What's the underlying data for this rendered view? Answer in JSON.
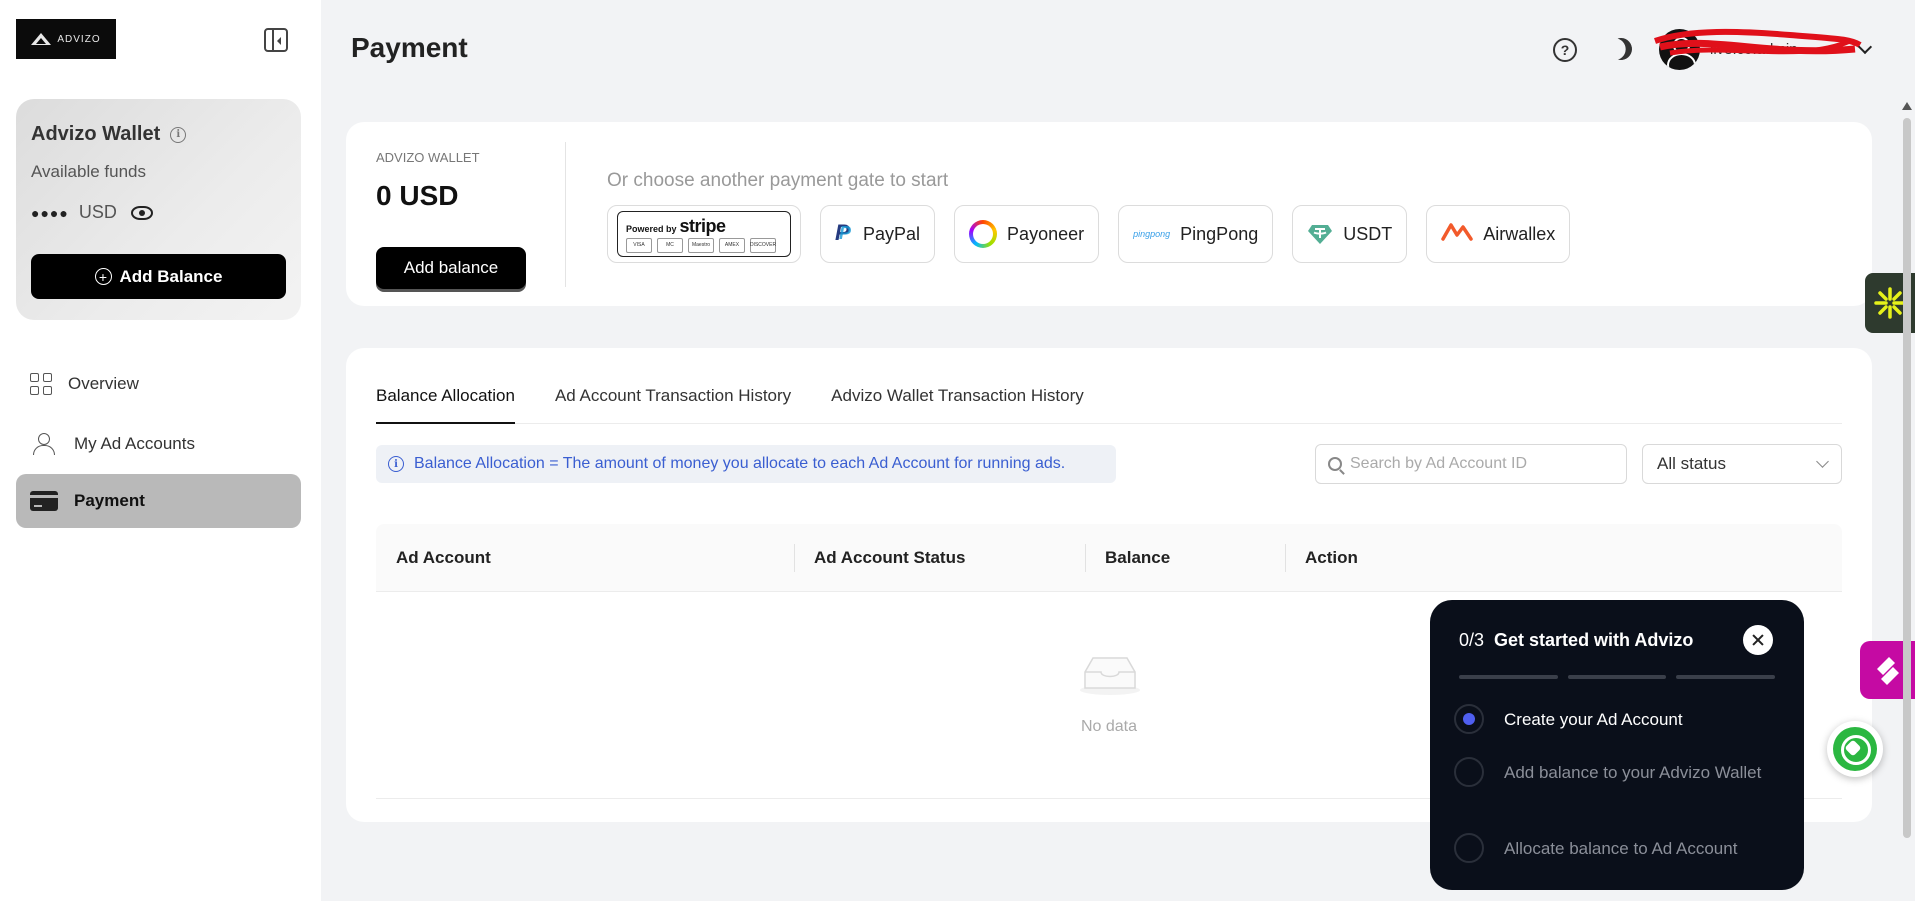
{
  "logo": {
    "text": "ADVIZO"
  },
  "sidebar": {
    "wallet": {
      "title": "Advizo Wallet",
      "available_label": "Available funds",
      "masked_amount": "●●●●",
      "currency": "USD",
      "add_balance_label": "Add Balance"
    },
    "items": [
      {
        "label": "Overview",
        "icon": "grid-icon"
      },
      {
        "label": "My Ad Accounts",
        "icon": "users-icon"
      },
      {
        "label": "Payment",
        "icon": "credit-card-icon",
        "active": true
      }
    ]
  },
  "header": {
    "title": "Payment",
    "user_name": "ilve.co.admin"
  },
  "wallet_panel": {
    "label": "ADVIZO WALLET",
    "amount": "0 USD",
    "add_balance_label": "Add balance",
    "gate_prompt": "Or choose another payment gate to start",
    "gates": [
      {
        "name": "stripe",
        "powered_by": "Powered by",
        "word": "stripe",
        "cards": [
          "VISA",
          "MC",
          "Maestro",
          "AMEX",
          "DISCOVER"
        ]
      },
      {
        "name": "PayPal"
      },
      {
        "name": "Payoneer"
      },
      {
        "name": "PingPong",
        "mark": "pingpong"
      },
      {
        "name": "USDT"
      },
      {
        "name": "Airwallex"
      }
    ]
  },
  "allocation": {
    "tabs": [
      "Balance Allocation",
      "Ad Account Transaction History",
      "Advizo Wallet Transaction History"
    ],
    "active_tab": 0,
    "info": "Balance Allocation = The amount of money you allocate to each Ad Account for running ads.",
    "search_placeholder": "Search by Ad Account ID",
    "status_filter": "All status",
    "columns": [
      "Ad Account",
      "Ad Account Status",
      "Balance",
      "Action"
    ],
    "empty_text": "No data"
  },
  "get_started": {
    "progress": "0/3",
    "title": "Get started with Advizo",
    "steps": [
      {
        "label": "Create your Ad Account",
        "active": true
      },
      {
        "label": "Add balance to your Advizo Wallet",
        "active": false
      },
      {
        "label": "Allocate balance to Ad Account",
        "active": false
      }
    ]
  },
  "colors": {
    "accent": "#4f5ff0",
    "info_text": "#3a5ed1",
    "popup_bg": "#0a0f1a",
    "whatsapp": "#2bb741",
    "pink_widget": "#c50aa3"
  }
}
